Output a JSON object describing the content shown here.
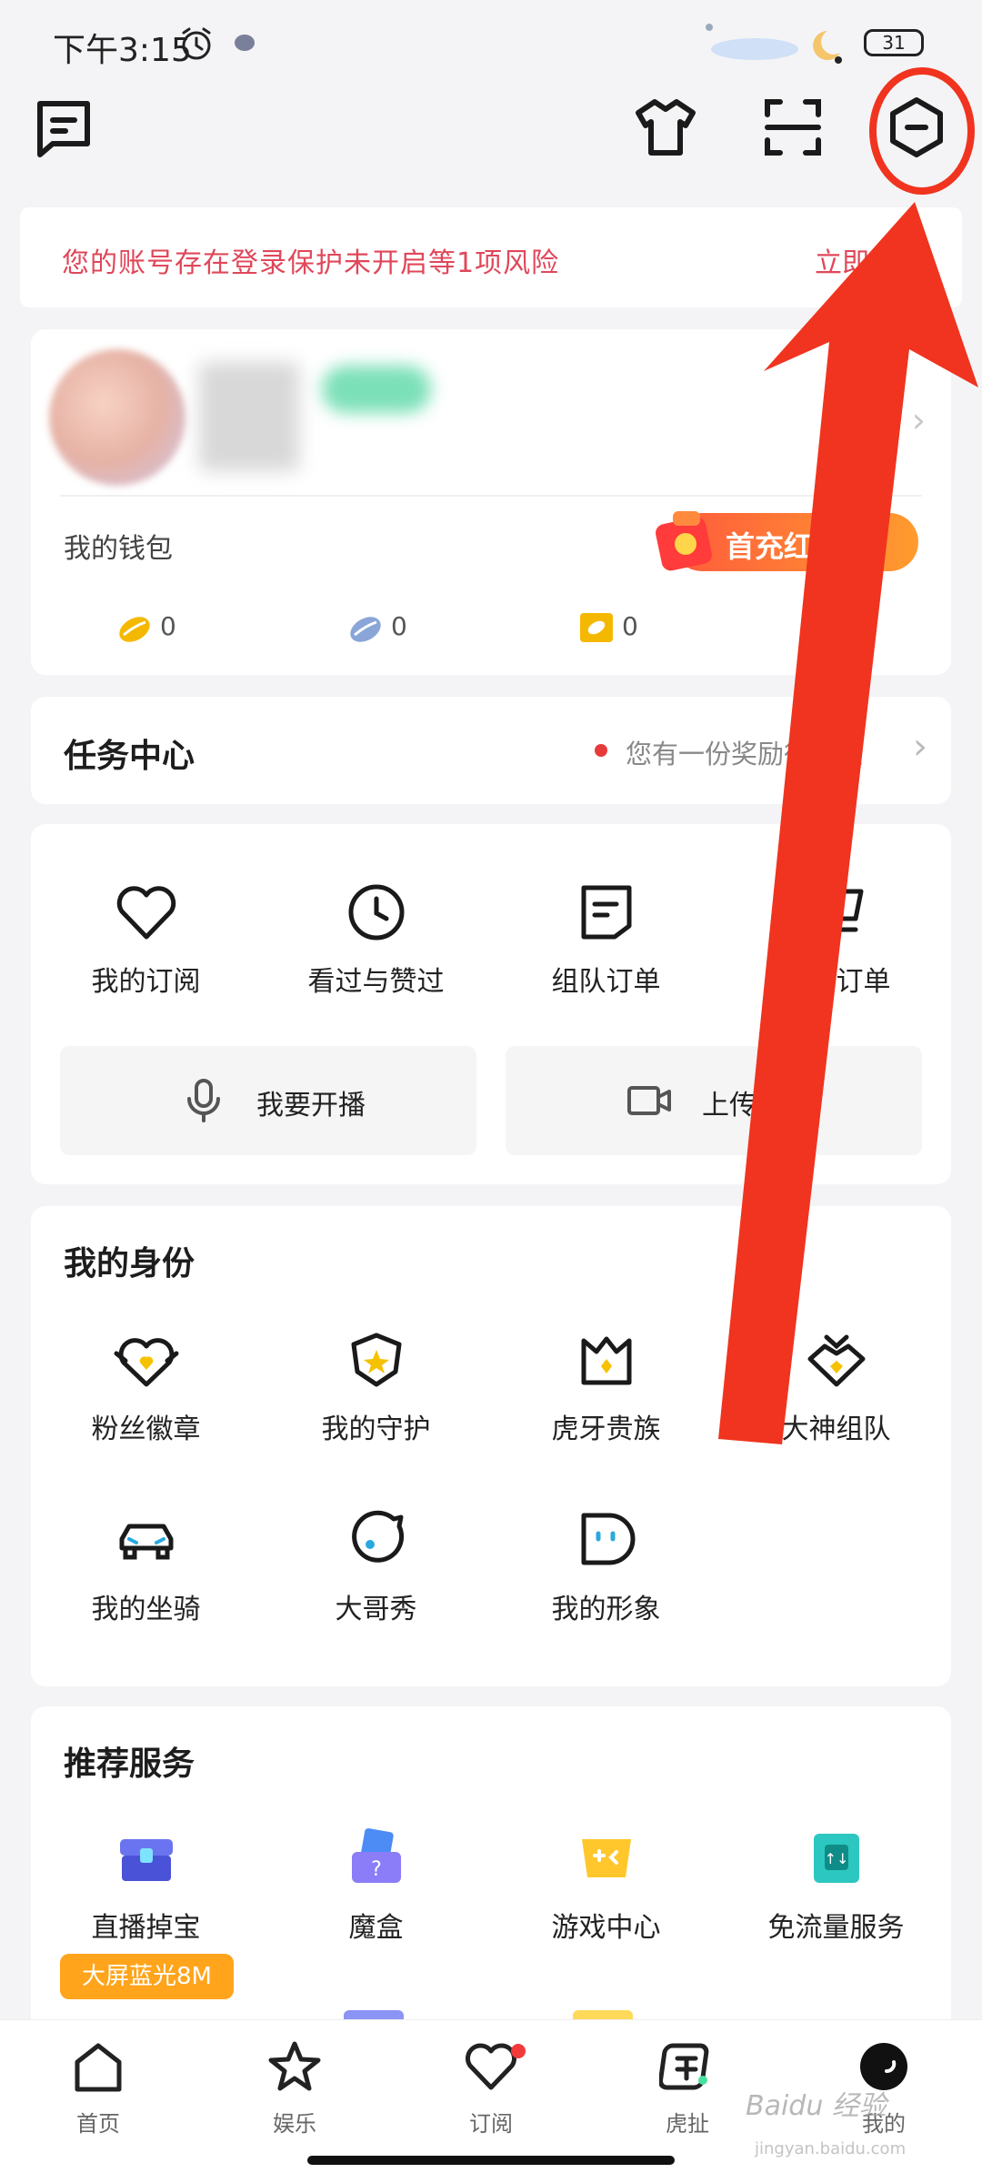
{
  "status_bar": {
    "time": "下午3:15",
    "battery": "31"
  },
  "risk_banner": {
    "text": "您的账号存在登录保护未开启等1项风险",
    "link": "立即查看"
  },
  "wallet": {
    "label": "我的钱包",
    "recharge_label": "首充红包",
    "coins": [
      {
        "name": "gold-bean",
        "value": "0",
        "color": "#f5b800"
      },
      {
        "name": "silver-bean",
        "value": "0",
        "color": "#8aa6d8"
      },
      {
        "name": "ticket",
        "value": "0",
        "color": "#f5b800"
      }
    ]
  },
  "task_center": {
    "title": "任务中心",
    "reward_text": "您有一份奖励待领取"
  },
  "shortcuts": [
    {
      "label": "我的订阅",
      "icon": "heart-icon"
    },
    {
      "label": "看过与赞过",
      "icon": "clock-icon"
    },
    {
      "label": "组队订单",
      "icon": "order-icon"
    },
    {
      "label": "购物订单",
      "icon": "cart-icon"
    }
  ],
  "actions": {
    "live": "我要开播",
    "upload": "上传视频"
  },
  "identity": {
    "title": "我的身份",
    "items": [
      {
        "label": "粉丝徽章",
        "icon": "fan-badge-icon"
      },
      {
        "label": "我的守护",
        "icon": "guard-icon"
      },
      {
        "label": "虎牙贵族",
        "icon": "crown-icon"
      },
      {
        "label": "大神组队",
        "icon": "god-team-icon"
      },
      {
        "label": "我的坐骑",
        "icon": "car-icon"
      },
      {
        "label": "大哥秀",
        "icon": "bigbro-icon"
      },
      {
        "label": "我的形象",
        "icon": "avatar-icon"
      }
    ]
  },
  "recommend": {
    "title": "推荐服务",
    "items": [
      {
        "label": "直播掉宝",
        "icon": "treasure-icon"
      },
      {
        "label": "魔盒",
        "icon": "magic-box-icon"
      },
      {
        "label": "游戏中心",
        "icon": "game-center-icon"
      },
      {
        "label": "免流量服务",
        "icon": "free-data-icon"
      }
    ],
    "promo_badge": "大屏蓝光8M"
  },
  "bottom_nav": [
    {
      "label": "首页",
      "icon": "home-icon"
    },
    {
      "label": "娱乐",
      "icon": "star-icon"
    },
    {
      "label": "订阅",
      "icon": "heart-icon"
    },
    {
      "label": "虎扯",
      "icon": "huche-icon"
    },
    {
      "label": "我的",
      "icon": "profile-icon"
    }
  ],
  "watermark": {
    "brand": "Baidu 经验",
    "url": "jingyan.baidu.com"
  },
  "colors": {
    "accent": "#ffa41b",
    "risk": "#e0475a",
    "annotation": "#f0341f"
  }
}
